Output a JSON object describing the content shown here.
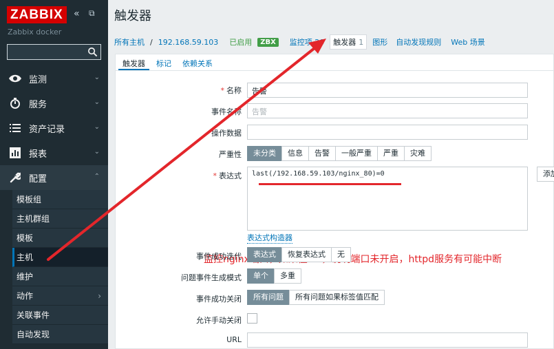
{
  "sidebar": {
    "logo": "ZABBIX",
    "collapse_icon": "«",
    "fullscreen_icon": "⧉",
    "server_name": "Zabbix docker",
    "search_value": "",
    "nav": [
      {
        "label": "监测",
        "icon": "eye-icon"
      },
      {
        "label": "服务",
        "icon": "clock-icon"
      },
      {
        "label": "资产记录",
        "icon": "list-icon"
      },
      {
        "label": "报表",
        "icon": "chart-icon"
      },
      {
        "label": "配置",
        "icon": "wrench-icon"
      }
    ],
    "submenu": [
      "模板组",
      "主机群组",
      "模板",
      "主机",
      "维护",
      "动作",
      "关联事件",
      "自动发现"
    ],
    "active_sub": "主机"
  },
  "page": {
    "title": "触发器",
    "breadcrumb": {
      "all_hosts": "所有主机",
      "sep": "/",
      "host": "192.168.59.103",
      "enabled": "已启用",
      "zbx": "ZBX",
      "items": "监控项 20",
      "triggers": "触发器",
      "triggers_count": "1",
      "graphs": "图形",
      "discovery": "自动发现规则",
      "web": "Web 场景"
    },
    "tabs": [
      "触发器",
      "标记",
      "依赖关系"
    ]
  },
  "form": {
    "name_label": "名称",
    "name_value": "告警",
    "event_name_label": "事件名称",
    "event_name_placeholder": "告警",
    "opdata_label": "操作数据",
    "opdata_value": "",
    "severity_label": "严重性",
    "severity_options": [
      "未分类",
      "信息",
      "告警",
      "一般严重",
      "严重",
      "灾难"
    ],
    "severity_selected": "未分类",
    "expression_label": "表达式",
    "expression_value": "last(/192.168.59.103/nginx_80)=0",
    "add_button": "添加",
    "expr_builder": "表达式构造器",
    "ok_event_gen_label": "事件成功迭代",
    "ok_event_gen_options": [
      "表达式",
      "恢复表达式",
      "无"
    ],
    "problem_mode_label": "问题事件生成模式",
    "problem_mode_options": [
      "单个",
      "多重"
    ],
    "ok_close_label": "事件成功关闭",
    "ok_close_options": [
      "所有问题",
      "所有问题如果标签值匹配"
    ],
    "manual_close_label": "允许手动关闭",
    "url_label": "URL",
    "url_value": ""
  },
  "annotation": "监控nginx端口，如果值=0，说明端口未开启，httpd服务有可能中断",
  "colors": {
    "sidebar_bg": "#1f2c33",
    "logo_red": "#d40000",
    "link_blue": "#0275b8",
    "enabled_green": "#429e47",
    "annotation_red": "#e3262b",
    "selected_seg": "#768d99"
  }
}
